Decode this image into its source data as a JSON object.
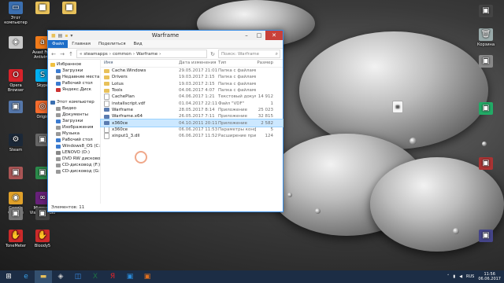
{
  "desktop": {
    "icons": [
      {
        "label": "Этот компьютер",
        "icon": "computer-icon",
        "color": "#3b6fb0"
      },
      {
        "label": "",
        "icon": "folder-icon",
        "color": "#e8c15a"
      },
      {
        "label": "",
        "icon": "folder-icon",
        "color": "#e8c15a"
      },
      {
        "label": "",
        "icon": "warframe-icon",
        "color": "#c9c9c9"
      },
      {
        "label": "Avast Free Antivirus",
        "icon": "avast-icon",
        "color": "#f07b1a"
      },
      {
        "label": "Opera Browser",
        "icon": "opera-icon",
        "color": "#d8222a"
      },
      {
        "label": "Skype",
        "icon": "skype-icon",
        "color": "#00aff0"
      },
      {
        "label": "",
        "icon": "app-icon",
        "color": "#5577aa"
      },
      {
        "label": "Origin",
        "icon": "origin-icon",
        "color": "#f56c2d"
      },
      {
        "label": "Steam",
        "icon": "steam-icon",
        "color": "#1b2838"
      },
      {
        "label": "",
        "icon": "app-icon",
        "color": "#666"
      },
      {
        "label": "",
        "icon": "app-icon",
        "color": "#888"
      },
      {
        "label": "",
        "icon": "app-icon",
        "color": "#a55"
      },
      {
        "label": "",
        "icon": "app-icon",
        "color": "#2a8a4a"
      },
      {
        "label": "",
        "icon": "app-icon",
        "color": "#555"
      },
      {
        "label": "Google Chrome",
        "icon": "chrome-icon",
        "color": "#e0a12a"
      },
      {
        "label": "Microsoft Visual Studio",
        "icon": "vs-icon",
        "color": "#68217a"
      },
      {
        "label": "",
        "icon": "app-icon",
        "color": "#777"
      },
      {
        "label": "",
        "icon": "app-icon",
        "color": "#444"
      },
      {
        "label": "ToneMeter",
        "icon": "hand-icon",
        "color": "#cc2a2a"
      },
      {
        "label": "Bloody5",
        "icon": "hand-icon",
        "color": "#cc2a2a"
      }
    ],
    "right_icons": [
      {
        "label": "",
        "icon": "app-icon",
        "color": "#444"
      },
      {
        "label": "Корзина",
        "icon": "recycle-bin-icon",
        "color": "#9aa"
      },
      {
        "label": "",
        "icon": "app-icon",
        "color": "#888"
      },
      {
        "label": "",
        "icon": "app-icon",
        "color": "#2a6"
      },
      {
        "label": "",
        "icon": "app-icon",
        "color": "#a33"
      },
      {
        "label": "",
        "icon": "app-icon",
        "color": "#448"
      }
    ],
    "file_on_desktop": {
      "label": "",
      "icon": "document-icon"
    }
  },
  "window": {
    "title": "Warframe",
    "tabs": [
      "Файл",
      "Главная",
      "Поделиться",
      "Вид"
    ],
    "path": [
      "steamapps",
      "common",
      "Warframe"
    ],
    "search_placeholder": "Поиск: Warframe",
    "columns": {
      "name": "Имя",
      "date": "Дата изменения",
      "type": "Тип",
      "size": "Размер"
    },
    "nav_items": [
      {
        "label": "Избранное",
        "color": "#f0c040"
      },
      {
        "label": "Загрузки",
        "color": "#3b7bd0"
      },
      {
        "label": "Недавние места",
        "color": "#888"
      },
      {
        "label": "Рабочий стол",
        "color": "#3b7bd0"
      },
      {
        "label": "Яндекс.Диск",
        "color": "#cc3333"
      },
      {
        "label": "",
        "color": "#fff"
      },
      {
        "label": "Этот компьютер",
        "color": "#3b6fb0"
      },
      {
        "label": "Видео",
        "color": "#999"
      },
      {
        "label": "Документы",
        "color": "#999"
      },
      {
        "label": "Загрузки",
        "color": "#3b7bd0"
      },
      {
        "label": "Изображения",
        "color": "#999"
      },
      {
        "label": "Музыка",
        "color": "#999"
      },
      {
        "label": "Рабочий стол",
        "color": "#3b7bd0"
      },
      {
        "label": "Windows8_OS (C:)",
        "color": "#3b7bd0"
      },
      {
        "label": "LENOVO (D:)",
        "color": "#888"
      },
      {
        "label": "DVD RW дисковод (E:)",
        "color": "#999"
      },
      {
        "label": "CD-дисковод (F:)",
        "color": "#999"
      },
      {
        "label": "CD-дисковод (G:)",
        "color": "#999"
      }
    ],
    "files": [
      {
        "name": "Cache.Windows",
        "date": "29.05.2017 21:01",
        "type": "Папка с файлами",
        "size": "",
        "kind": "folder"
      },
      {
        "name": "Drivers",
        "date": "19.03.2017 2:15",
        "type": "Папка с файлами",
        "size": "",
        "kind": "folder"
      },
      {
        "name": "Lotus",
        "date": "19.03.2017 2:15",
        "type": "Папка с файлами",
        "size": "",
        "kind": "folder"
      },
      {
        "name": "Tools",
        "date": "04.06.2017 4:07",
        "type": "Папка с файлами",
        "size": "",
        "kind": "folder"
      },
      {
        "name": "CachePlan",
        "date": "04.06.2017 1:21",
        "type": "Текстовый докум...",
        "size": "14 912",
        "kind": "file"
      },
      {
        "name": "installscript.vdf",
        "date": "01.04.2017 22:11",
        "type": "Файл \"VDF\"",
        "size": "1",
        "kind": "file"
      },
      {
        "name": "Warframe",
        "date": "28.05.2017 8:14",
        "type": "Приложение",
        "size": "25 023",
        "kind": "app"
      },
      {
        "name": "Warframe.x64",
        "date": "26.05.2017 7:11",
        "type": "Приложение",
        "size": "32 815",
        "kind": "app"
      },
      {
        "name": "x360ce",
        "date": "04.10.2011 20:11",
        "type": "Приложение",
        "size": "2 582",
        "kind": "app",
        "selected": true
      },
      {
        "name": "x360ce",
        "date": "06.06.2017 11:53",
        "type": "Параметры конф...",
        "size": "5",
        "kind": "file"
      },
      {
        "name": "xinput1_3.dll",
        "date": "06.06.2017 11:52",
        "type": "Расширение при...",
        "size": "124",
        "kind": "file"
      }
    ],
    "status": "Элементов: 11"
  },
  "taskbar": {
    "items": [
      {
        "icon": "start-icon",
        "color": "#fff"
      },
      {
        "icon": "ie-icon",
        "color": "#3aa0e8"
      },
      {
        "icon": "explorer-icon",
        "color": "#e8c15a",
        "active": true
      },
      {
        "icon": "warframe-icon",
        "color": "#ccc"
      },
      {
        "icon": "store-icon",
        "color": "#3a8ee6"
      },
      {
        "icon": "excel-icon",
        "color": "#1e7145"
      },
      {
        "icon": "yandex-icon",
        "color": "#e8252a"
      },
      {
        "icon": "app-icon",
        "color": "#2a8ad8"
      },
      {
        "icon": "app-icon",
        "color": "#e07020"
      }
    ],
    "language": "RUS",
    "time": "11:56",
    "date": "06.06.2017"
  }
}
